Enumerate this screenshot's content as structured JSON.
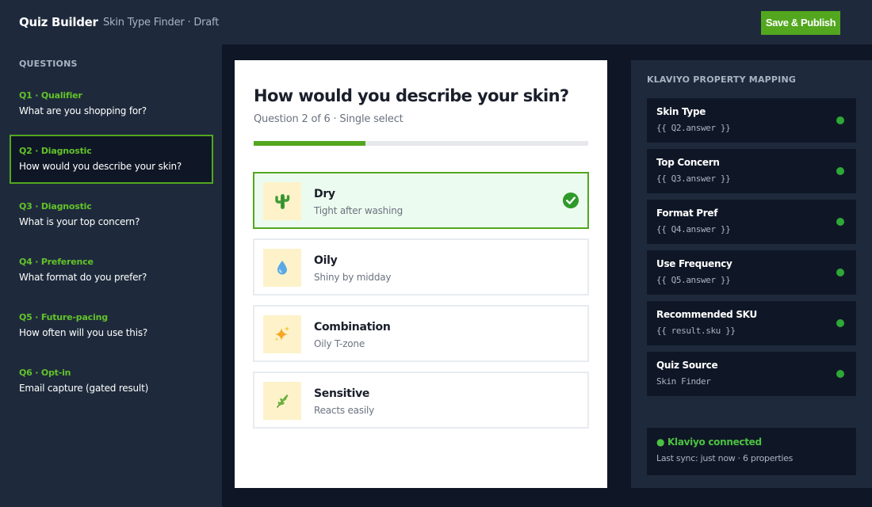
{
  "header": {
    "app_title": "Quiz Builder",
    "subtitle": "Skin Type Finder · Draft",
    "publish_label": "Save & Publish"
  },
  "sidebar": {
    "heading": "QUESTIONS",
    "active_index": 1,
    "items": [
      {
        "tag": "Q1 · Qualifier",
        "text": "What are you shopping for?"
      },
      {
        "tag": "Q2 · Diagnostic",
        "text": "How would you describe your skin?"
      },
      {
        "tag": "Q3 · Diagnostic",
        "text": "What is your top concern?"
      },
      {
        "tag": "Q4 · Preference",
        "text": "What format do you prefer?"
      },
      {
        "tag": "Q5 · Future-pacing",
        "text": "How often will you use this?"
      },
      {
        "tag": "Q6 · Opt-in",
        "text": "Email capture (gated result)"
      }
    ]
  },
  "question": {
    "title": "How would you describe your skin?",
    "meta": "Question 2 of 6 · Single select",
    "progress": 0.333,
    "options": [
      {
        "label": "Dry",
        "description": "Tight after washing",
        "icon": "cactus-icon",
        "selected": true
      },
      {
        "label": "Oily",
        "description": "Shiny by midday",
        "icon": "droplet-icon",
        "selected": false
      },
      {
        "label": "Combination",
        "description": "Oily T-zone",
        "icon": "sparkles-icon",
        "selected": false
      },
      {
        "label": "Sensitive",
        "description": "Reacts easily",
        "icon": "herb-icon",
        "selected": false
      }
    ]
  },
  "mapping": {
    "heading": "KLAVIYO PROPERTY MAPPING",
    "rows": [
      {
        "name": "Skin Type",
        "value": "{{ Q2.answer }}"
      },
      {
        "name": "Top Concern",
        "value": "{{ Q3.answer }}"
      },
      {
        "name": "Format Pref",
        "value": "{{ Q4.answer }}"
      },
      {
        "name": "Use Frequency",
        "value": "{{ Q5.answer }}"
      },
      {
        "name": "Recommended SKU",
        "value": "{{ result.sku }}"
      },
      {
        "name": "Quiz Source",
        "value": "Skin Finder"
      }
    ],
    "connection": {
      "status": "● Klaviyo connected",
      "sync": "Last sync: just now · 6 properties"
    }
  },
  "colors": {
    "accent": "#52a71f",
    "tag_green": "#63c22a",
    "panel": "#1e2a3c",
    "background": "#0f1726",
    "selected_bg": "#ecfbef",
    "status_dot": "#2ea836"
  }
}
